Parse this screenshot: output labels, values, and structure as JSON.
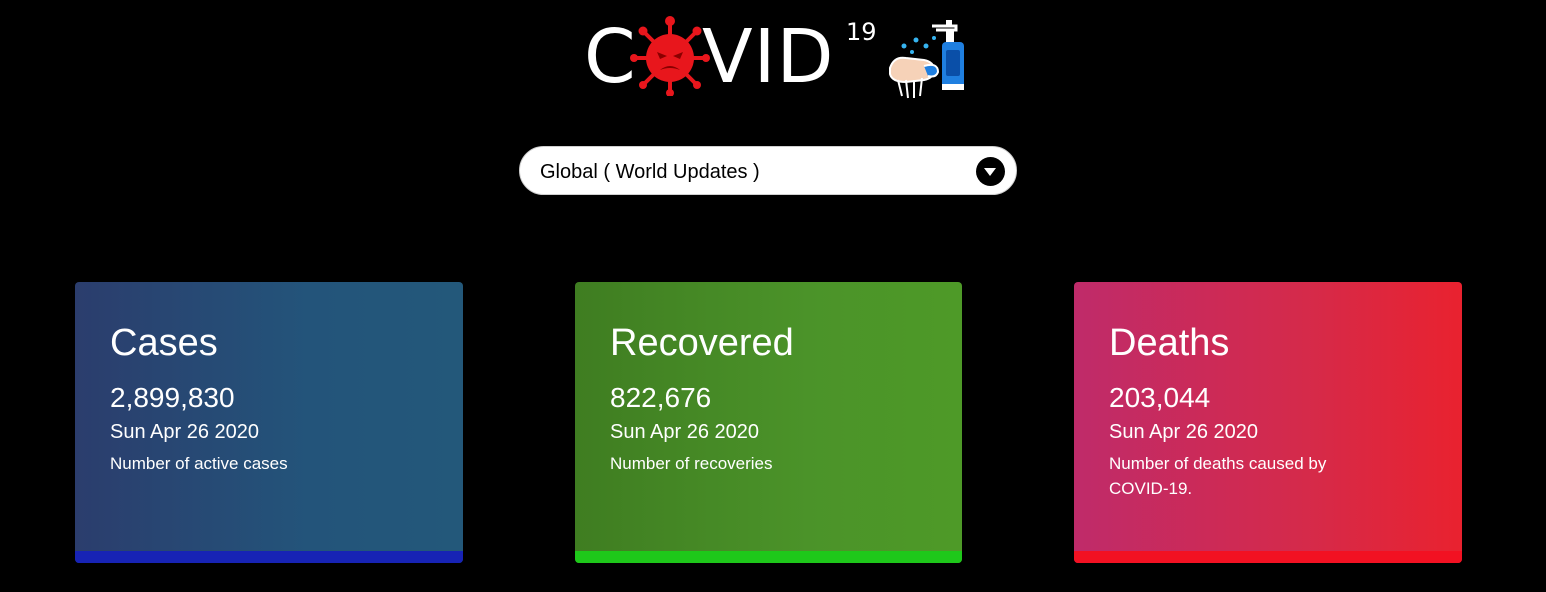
{
  "header": {
    "logo_c": "C",
    "logo_vid": "VID",
    "logo_sup": "19",
    "virus_icon": "virus-icon",
    "virus_color": "#e8161c",
    "handwash_icon": "handwash-sanitizer-icon"
  },
  "region_select": {
    "value": "Global ( World Updates )",
    "caret_icon": "chevron-down-icon"
  },
  "cards": [
    {
      "title": "Cases",
      "count": "2,899,830",
      "date": "Sun Apr 26 2020",
      "description": "Number of active cases",
      "accent": "#1723b5"
    },
    {
      "title": "Recovered",
      "count": "822,676",
      "date": "Sun Apr 26 2020",
      "description": "Number of recoveries",
      "accent": "#1ec81a"
    },
    {
      "title": "Deaths",
      "count": "203,044",
      "date": "Sun Apr 26 2020",
      "description": "Number of deaths caused by COVID-19.",
      "accent": "#f21122"
    }
  ]
}
